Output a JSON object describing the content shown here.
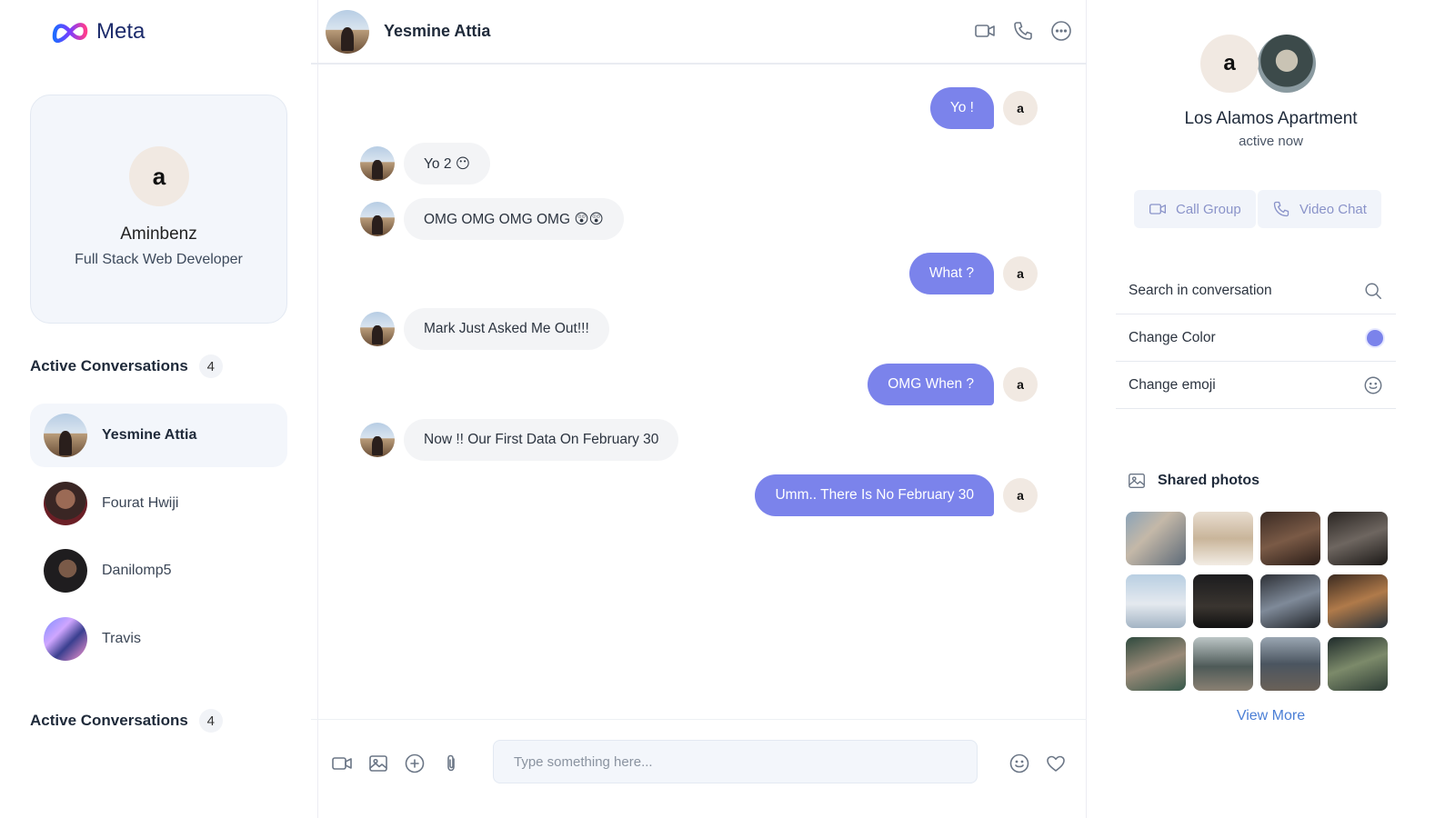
{
  "brand": {
    "name": "Meta"
  },
  "profile": {
    "initial": "a",
    "name": "Aminbenz",
    "role": "Full Stack Web Developer"
  },
  "active_conversations": {
    "title": "Active Conversations",
    "count": "4"
  },
  "active_conversations_2": {
    "title": "Active Conversations",
    "count": "4"
  },
  "conversations": [
    {
      "name": "Yesmine Attia",
      "active": true
    },
    {
      "name": "Fourat Hwiji",
      "active": false
    },
    {
      "name": "Danilomp5",
      "active": false
    },
    {
      "name": "Travis",
      "active": false
    }
  ],
  "chat": {
    "contact_name": "Yesmine Attia",
    "self_initial": "a",
    "messages": [
      {
        "dir": "out",
        "text": "Yo !"
      },
      {
        "dir": "in",
        "text": "Yo 2 😶"
      },
      {
        "dir": "in",
        "text": "OMG OMG OMG OMG 😲😲"
      },
      {
        "dir": "out",
        "text": "What ?"
      },
      {
        "dir": "in",
        "text": "Mark Just Asked Me Out!!!"
      },
      {
        "dir": "out",
        "text": "OMG When ?"
      },
      {
        "dir": "in",
        "text": "Now !! Our First Data On February 30"
      },
      {
        "dir": "out",
        "text": "Umm.. There Is No February 30"
      }
    ],
    "input_placeholder": "Type something here..."
  },
  "details": {
    "initial": "a",
    "group_name": "Los Alamos Apartment",
    "status": "active now",
    "call_group_label": "Call Group",
    "video_chat_label": "Video Chat",
    "options": {
      "search": "Search in conversation",
      "color": "Change Color",
      "emoji": "Change emoji"
    },
    "accent_color": "#7b83eb",
    "shared_photos_title": "Shared photos",
    "view_more": "View More"
  }
}
